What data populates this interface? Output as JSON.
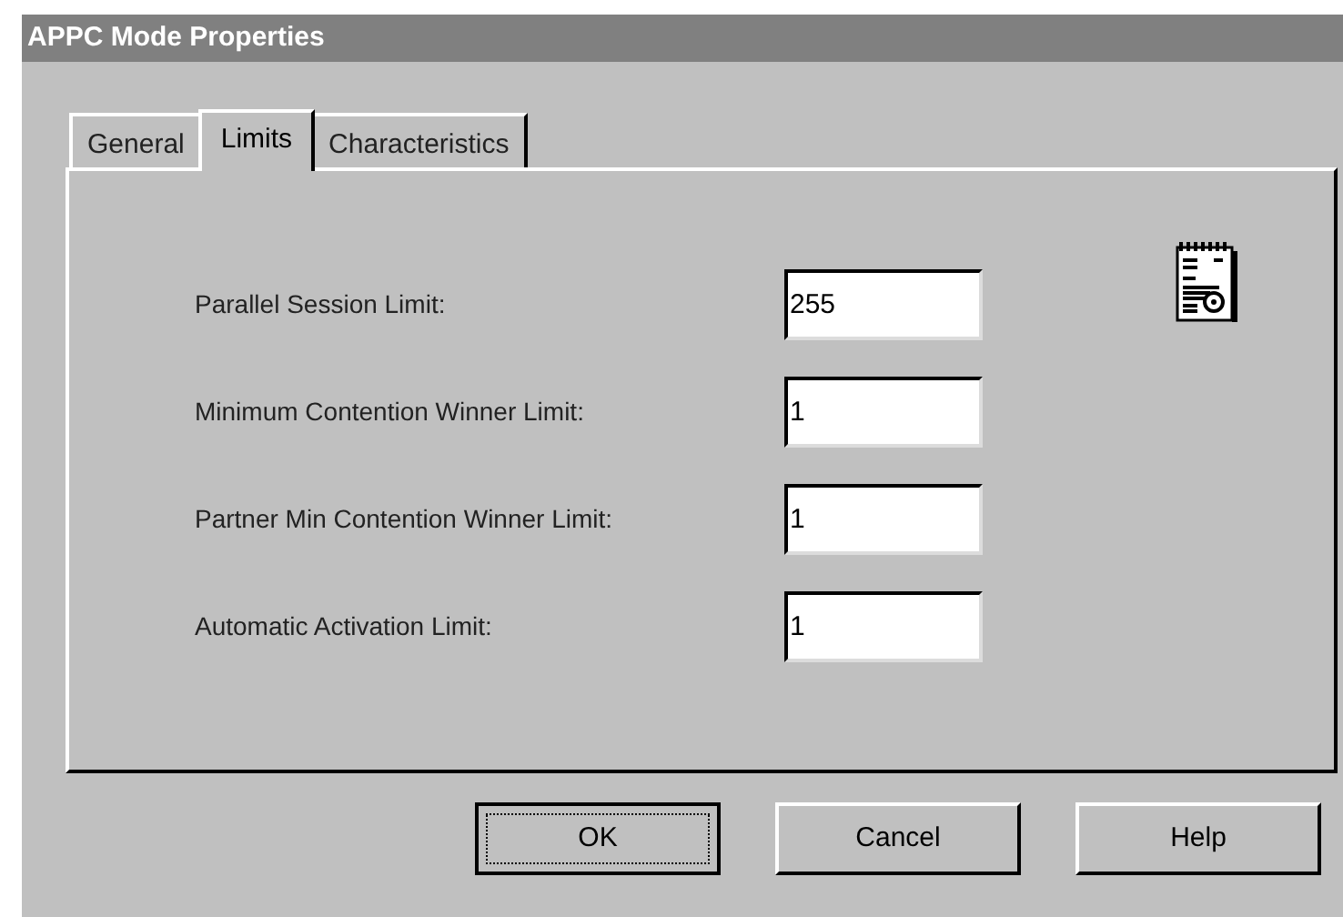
{
  "window": {
    "title": "APPC Mode Properties"
  },
  "tabs": [
    {
      "label": "General",
      "selected": false
    },
    {
      "label": "Limits",
      "selected": true
    },
    {
      "label": "Characteristics",
      "selected": false
    }
  ],
  "fields": [
    {
      "label": "Parallel Session Limit:",
      "value": "255"
    },
    {
      "label": "Minimum Contention Winner Limit:",
      "value": "1"
    },
    {
      "label": "Partner Min Contention Winner Limit:",
      "value": "1"
    },
    {
      "label": "Automatic Activation Limit:",
      "value": "1"
    }
  ],
  "buttons": [
    {
      "label": "OK",
      "default": true
    },
    {
      "label": "Cancel",
      "default": false
    },
    {
      "label": "Help",
      "default": false
    }
  ]
}
